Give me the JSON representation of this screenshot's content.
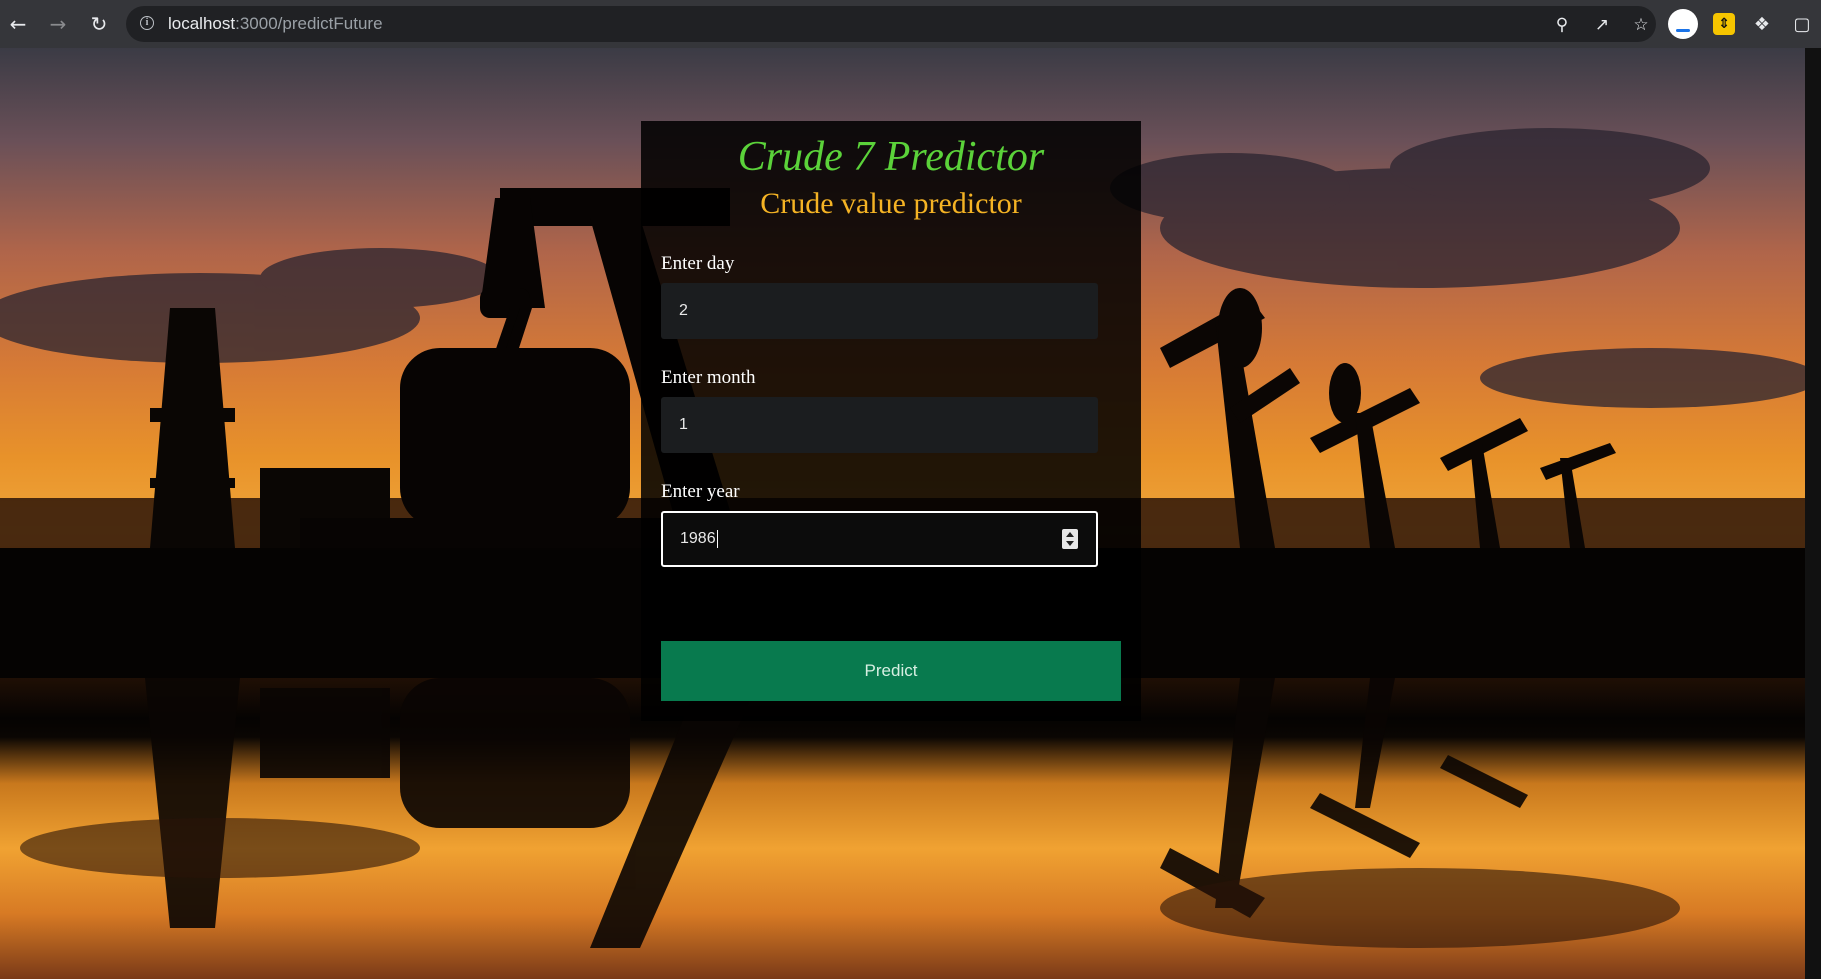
{
  "browser": {
    "url_host": "localhost",
    "url_rest": ":3000/predictFuture",
    "icons": {
      "back": "back-arrow-icon",
      "forward": "forward-arrow-icon",
      "reload": "reload-icon",
      "site_info": "info-icon",
      "password": "key-icon",
      "share": "share-icon",
      "bookmark": "star-icon",
      "extensions": "puzzle-icon",
      "side_panel": "side-panel-icon"
    }
  },
  "form": {
    "title": "Crude 7 Predictor",
    "subtitle": "Crude value predictor",
    "day_label": "Enter day",
    "day_value": "2",
    "month_label": "Enter month",
    "month_value": "1",
    "year_label": "Enter year",
    "year_value": "1986",
    "predict_label": "Predict"
  },
  "colors": {
    "title": "#5bd23a",
    "subtitle": "#f5b324",
    "button": "#087a4e"
  }
}
